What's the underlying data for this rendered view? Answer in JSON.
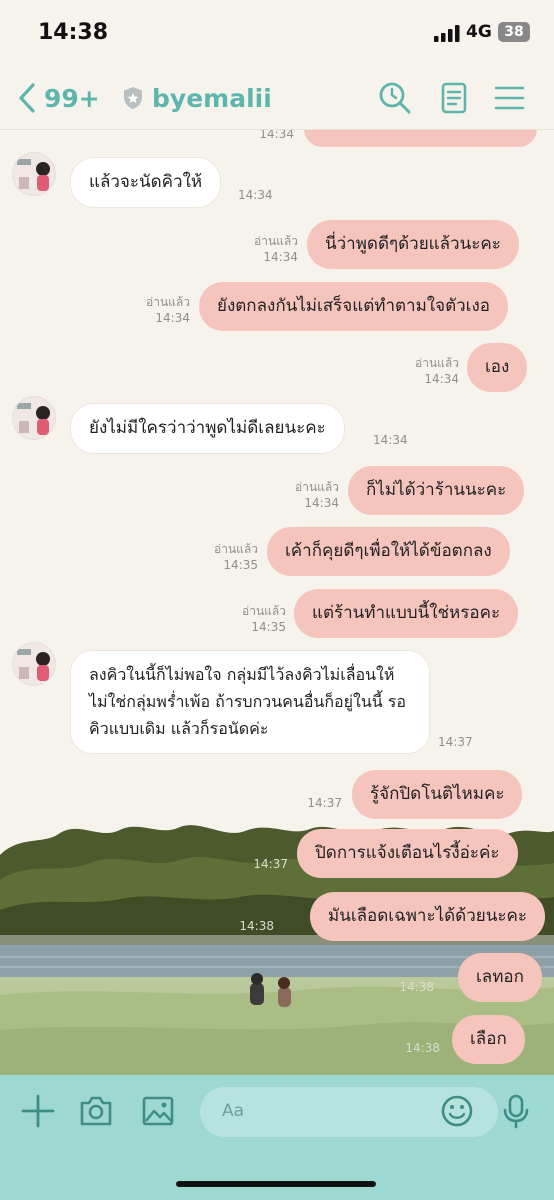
{
  "status_bar": {
    "time": "14:38",
    "network": "4G",
    "battery": "38"
  },
  "header": {
    "back_count": "99+",
    "chat_name": "byemalii"
  },
  "messages": [
    {
      "side": "out",
      "text": "",
      "time": "14:34"
    },
    {
      "side": "in",
      "text": "แล้วจะนัดคิวให้",
      "time": "14:34"
    },
    {
      "side": "out",
      "read": "อ่านแล้ว",
      "text": "นี่ว่าพูดดีๆด้วยแล้วนะคะ",
      "time": "14:34"
    },
    {
      "side": "out",
      "read": "อ่านแล้ว",
      "text": "ยังตกลงกันไม่เสร็จแต่ทำตามใจตัวเงอ",
      "time": "14:34"
    },
    {
      "side": "out",
      "read": "อ่านแล้ว",
      "text": "เอง",
      "time": "14:34"
    },
    {
      "side": "in",
      "text": "ยังไม่มีใครว่าว่าพูดไม่ดีเลยนะคะ",
      "time": "14:34"
    },
    {
      "side": "out",
      "read": "อ่านแล้ว",
      "text": "ก็ไม่ได้ว่าร้านนะคะ",
      "time": "14:34"
    },
    {
      "side": "out",
      "read": "อ่านแล้ว",
      "text": "เค้าก็คุยดีๆเพื่อให้ได้ข้อตกลง",
      "time": "14:35"
    },
    {
      "side": "out",
      "read": "อ่านแล้ว",
      "text": "แต่ร้านทำแบบนี้ใช่หรอคะ",
      "time": "14:35"
    },
    {
      "side": "in",
      "text": "ลงคิวในนี้ก็ไม่พอใจ  กลุ่มมีไว้ลงคิวไม่เลื่อนให้ ไม่ใช่กลุ่มพร่ำเพ้อ ถ้ารบกวนคนอื่นก็อยู่ในนี้ รอคิวแบบเดิม แล้วก็รอนัดค่ะ",
      "time": "14:37"
    },
    {
      "side": "out",
      "text": "รู้จักปิดโนติไหมคะ",
      "time": "14:37"
    },
    {
      "side": "out",
      "text": "ปิดการแจ้งเตือนไรงี้อ่ะค่ะ",
      "time": "14:37"
    },
    {
      "side": "out",
      "text": "มันเลือดเฉพาะได้ด้วยนะคะ",
      "time": "14:38"
    },
    {
      "side": "out",
      "text": "เลทอก",
      "time": "14:38"
    },
    {
      "side": "out",
      "text": "เลือก",
      "time": "14:38"
    }
  ],
  "input_bar": {
    "placeholder": "Aa"
  },
  "colors": {
    "accent": "#5db5ad",
    "outgoing_bubble": "#f5c4bd",
    "incoming_bubble": "#ffffff",
    "input_bar": "#9ed9d1"
  },
  "icons": [
    "chevron-left-icon",
    "shield-icon",
    "search-icon",
    "notes-icon",
    "menu-icon",
    "plus-icon",
    "camera-icon",
    "image-icon",
    "emoji-icon",
    "microphone-icon"
  ]
}
